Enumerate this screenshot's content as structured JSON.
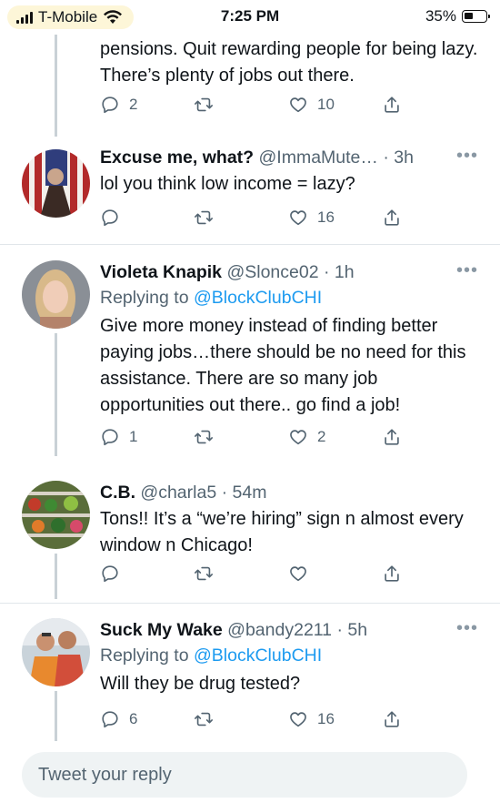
{
  "status_bar": {
    "carrier": "T-Mobile",
    "time": "7:25 PM",
    "battery": "35%"
  },
  "tweets": [
    {
      "text": "pensions. Quit rewarding people for being lazy. There’s plenty of jobs out there.",
      "replies": "2",
      "retweets": "",
      "likes": "10"
    },
    {
      "name": "Excuse me, what?",
      "handle": "@ImmaMute…",
      "time": "· 3h",
      "text": "lol you think low income = lazy?",
      "replies": "",
      "retweets": "",
      "likes": "16"
    },
    {
      "name": "Violeta Knapik",
      "handle": "@Slonce02",
      "time": "· 1h",
      "replying_prefix": "Replying to ",
      "replying_to": "@BlockClubCHI",
      "text": "Give more money instead of finding better paying jobs…there should be no need for this assistance. There are so many job opportunities out there.. go find a job!",
      "replies": "1",
      "retweets": "",
      "likes": "2"
    },
    {
      "name": "C.B.",
      "handle": "@charla5",
      "time": "· 54m",
      "text": "Tons!! It’s a “we’re hiring” sign n almost every window n Chicago!",
      "replies": "",
      "retweets": "",
      "likes": ""
    },
    {
      "name": "Suck My Wake",
      "handle": "@bandy2211",
      "time": "· 5h",
      "replying_prefix": "Replying to ",
      "replying_to": "@BlockClubCHI",
      "text": "Will they be drug tested?",
      "replies": "6",
      "retweets": "",
      "likes": "16"
    }
  ],
  "reply_bar": {
    "placeholder": "Tweet your reply"
  },
  "colors": {
    "link": "#1d9bf0",
    "muted": "#536471",
    "divider": "#e1e6ea",
    "thread": "#c9d1d6"
  }
}
